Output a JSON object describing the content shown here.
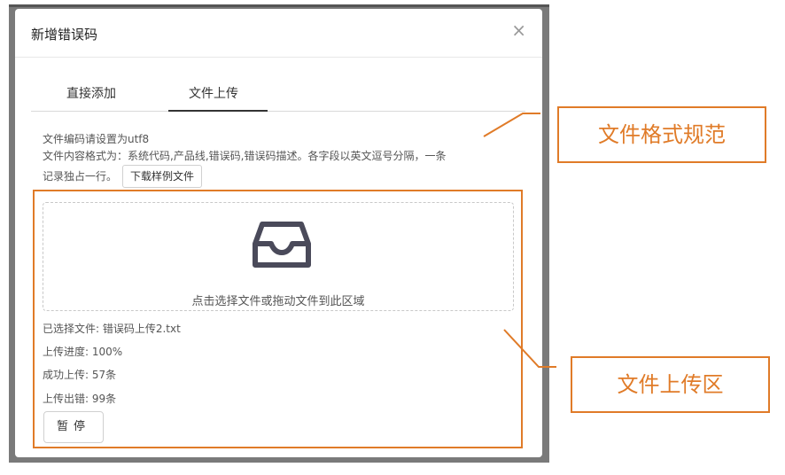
{
  "dialog": {
    "title": "新增错误码",
    "close_icon_char": "×"
  },
  "tabs": [
    {
      "label": "直接添加"
    },
    {
      "label": "文件上传",
      "active": true
    }
  ],
  "notes": {
    "line1": "文件编码请设置为utf8",
    "line2": "文件内容格式为：系统代码,产品线,错误码,错误码描述。各字段以英文逗号分隔，一条",
    "line3": "记录独占一行。",
    "sample_button": "下载样例文件"
  },
  "dropzone": {
    "icon": "inbox-icon",
    "text": "点击选择文件或拖动文件到此区域"
  },
  "status": {
    "selected_file": "已选择文件: 错误码上传2.txt",
    "progress": "上传进度: 100%",
    "success": "成功上传: 57条",
    "errors": "上传出错: 99条"
  },
  "pause_button": "暂停",
  "annotations": {
    "format_label": "文件格式规范",
    "upload_label": "文件上传区",
    "color": "#e07b28"
  }
}
